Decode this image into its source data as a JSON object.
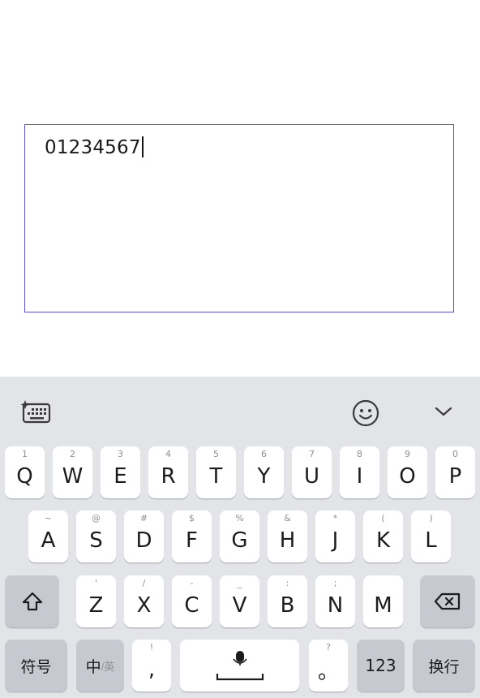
{
  "input": {
    "value": "01234567"
  },
  "toolbar": {
    "icons": [
      "keyboard-ai-icon",
      "emoji-icon",
      "chevron-down-icon"
    ]
  },
  "keyboard": {
    "row1": [
      {
        "hint": "1",
        "label": "Q"
      },
      {
        "hint": "2",
        "label": "W"
      },
      {
        "hint": "3",
        "label": "E"
      },
      {
        "hint": "4",
        "label": "R"
      },
      {
        "hint": "5",
        "label": "T"
      },
      {
        "hint": "6",
        "label": "Y"
      },
      {
        "hint": "7",
        "label": "U"
      },
      {
        "hint": "8",
        "label": "I"
      },
      {
        "hint": "9",
        "label": "O"
      },
      {
        "hint": "0",
        "label": "P"
      }
    ],
    "row2": [
      {
        "hint": "~",
        "label": "A"
      },
      {
        "hint": "@",
        "label": "S"
      },
      {
        "hint": "#",
        "label": "D"
      },
      {
        "hint": "$",
        "label": "F"
      },
      {
        "hint": "%",
        "label": "G"
      },
      {
        "hint": "&",
        "label": "H"
      },
      {
        "hint": "*",
        "label": "J"
      },
      {
        "hint": "(",
        "label": "K"
      },
      {
        "hint": ")",
        "label": "L"
      }
    ],
    "row3": [
      {
        "hint": "'",
        "label": "Z"
      },
      {
        "hint": "/",
        "label": "X"
      },
      {
        "hint": "-",
        "label": "C"
      },
      {
        "hint": "_",
        "label": "V"
      },
      {
        "hint": ":",
        "label": "B"
      },
      {
        "hint": ";",
        "label": "N"
      },
      {
        "hint": "",
        "label": "M"
      }
    ],
    "symbols_label": "符号",
    "lang_zh": "中",
    "lang_en": "/英",
    "comma": {
      "hint": "!",
      "label": ","
    },
    "period": {
      "hint": "?",
      "label": "。"
    },
    "num_label": "123",
    "enter_label": "换行"
  }
}
